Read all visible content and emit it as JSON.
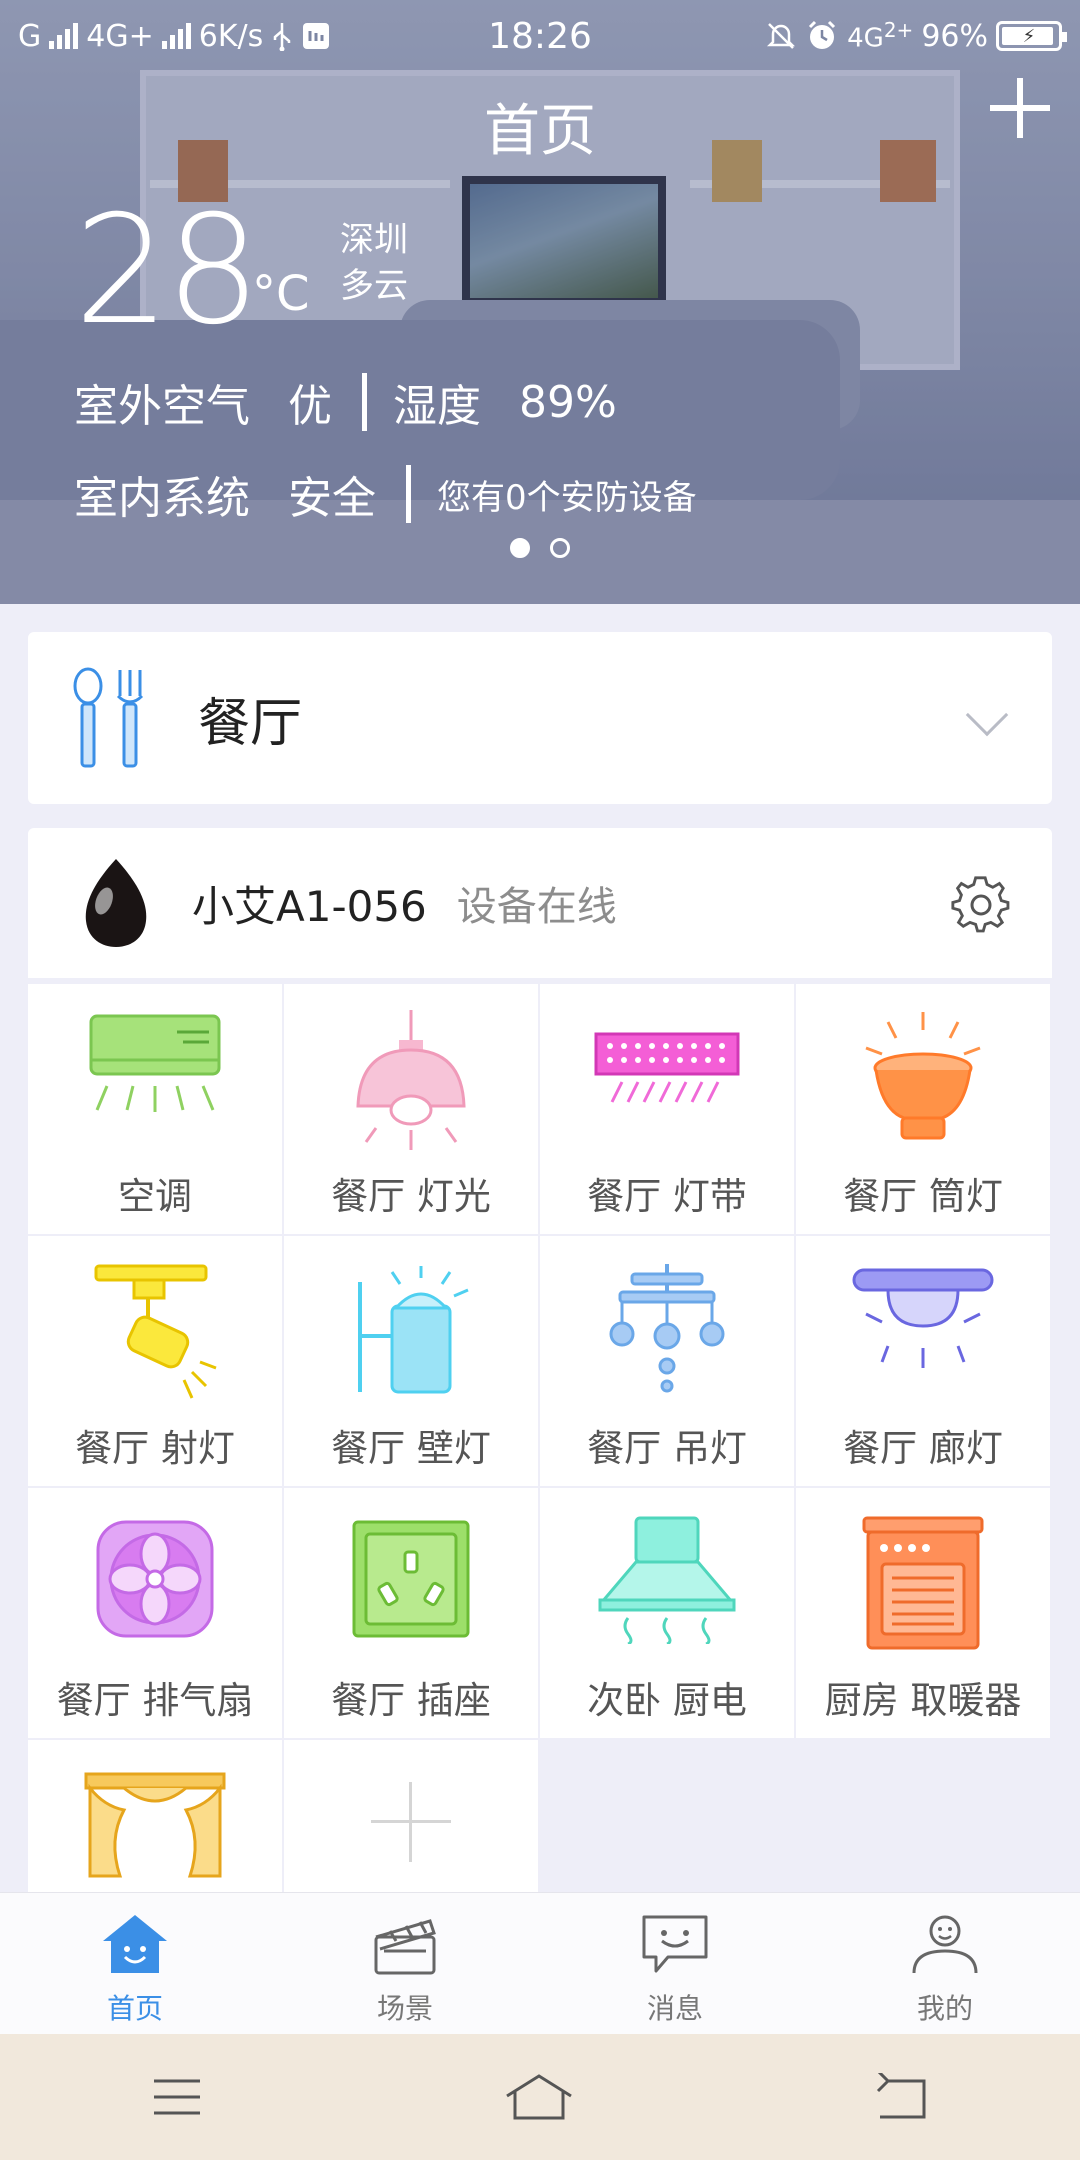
{
  "status_bar": {
    "carrier1": "G",
    "net1": "4G+",
    "speed": "6K/s",
    "time": "18:26",
    "net2": "4G",
    "net2_sub": "2+",
    "battery": "96%"
  },
  "header": {
    "title": "首页"
  },
  "weather": {
    "temperature": "28",
    "unit": "°C",
    "city": "深圳",
    "condition": "多云",
    "outdoor_air_label": "室外空气",
    "outdoor_air_value": "优",
    "humidity_label": "湿度",
    "humidity_value": "89%",
    "indoor_label": "室内系统",
    "indoor_value": "安全",
    "security_text": "您有0个安防设备"
  },
  "carousel": {
    "page_count": 2,
    "active_index": 0
  },
  "room": {
    "name": "餐厅"
  },
  "device": {
    "name": "小艾A1-056",
    "status": "设备在线"
  },
  "appliances": [
    {
      "label": "空调",
      "icon": "air-conditioner-icon"
    },
    {
      "label": "餐厅 灯光",
      "icon": "pendant-lamp-icon"
    },
    {
      "label": "餐厅 灯带",
      "icon": "light-strip-icon"
    },
    {
      "label": "餐厅 筒灯",
      "icon": "downlight-icon"
    },
    {
      "label": "餐厅 射灯",
      "icon": "spotlight-icon"
    },
    {
      "label": "餐厅 壁灯",
      "icon": "wall-lamp-icon"
    },
    {
      "label": "餐厅 吊灯",
      "icon": "chandelier-icon"
    },
    {
      "label": "餐厅 廊灯",
      "icon": "corridor-lamp-icon"
    },
    {
      "label": "餐厅 排气扇",
      "icon": "exhaust-fan-icon"
    },
    {
      "label": "餐厅 插座",
      "icon": "power-socket-icon"
    },
    {
      "label": "次卧 厨电",
      "icon": "range-hood-icon"
    },
    {
      "label": "厨房 取暖器",
      "icon": "heater-icon"
    }
  ],
  "tabs": [
    {
      "label": "首页",
      "icon": "home-icon",
      "active": true
    },
    {
      "label": "场景",
      "icon": "clapperboard-icon",
      "active": false
    },
    {
      "label": "消息",
      "icon": "message-icon",
      "active": false
    },
    {
      "label": "我的",
      "icon": "profile-icon",
      "active": false
    }
  ],
  "colors": {
    "accent": "#3b8fe6",
    "ac": "#a6e27a",
    "pendant": "#f7b8d0",
    "strip": "#f45ed6",
    "downlight": "#ff9247",
    "spot": "#fbe83c",
    "wall": "#7fd6f2",
    "chandelier": "#6aa7e8",
    "corridor": "#8e8cf0",
    "fan": "#d87cf0",
    "socket": "#9ddf6a",
    "hood": "#8ef0de",
    "heater": "#ff8f58",
    "curtain": "#f7c95c"
  }
}
